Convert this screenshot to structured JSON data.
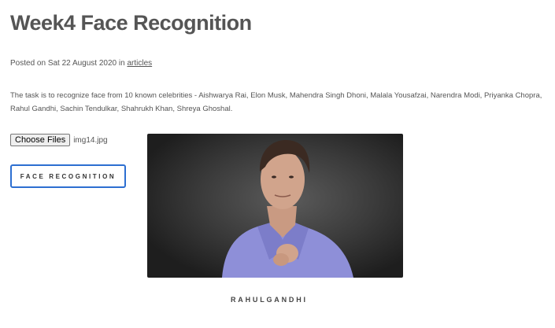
{
  "post": {
    "title": "Week4 Face Recognition",
    "posted_prefix": "Posted on Sat 22 August 2020 in ",
    "category": "articles",
    "description": "The task is to recognize face from 10 known celebrities - Aishwarya Rai, Elon Musk, Mahendra Singh Dhoni, Malala Yousafzai, Narendra Modi, Priyanka Chopra, Rahul Gandhi, Sachin Tendulkar, Shahrukh Khan, Shreya Ghoshal."
  },
  "upload": {
    "choose_label": "Choose Files",
    "file_name": "img14.jpg"
  },
  "action": {
    "recognize_label": "FACE RECOGNITION"
  },
  "result": {
    "label": "RAHULGANDHI"
  },
  "colors": {
    "button_border": "#2d6fd1",
    "title": "#555555",
    "shirt": "#8e8fd8"
  }
}
